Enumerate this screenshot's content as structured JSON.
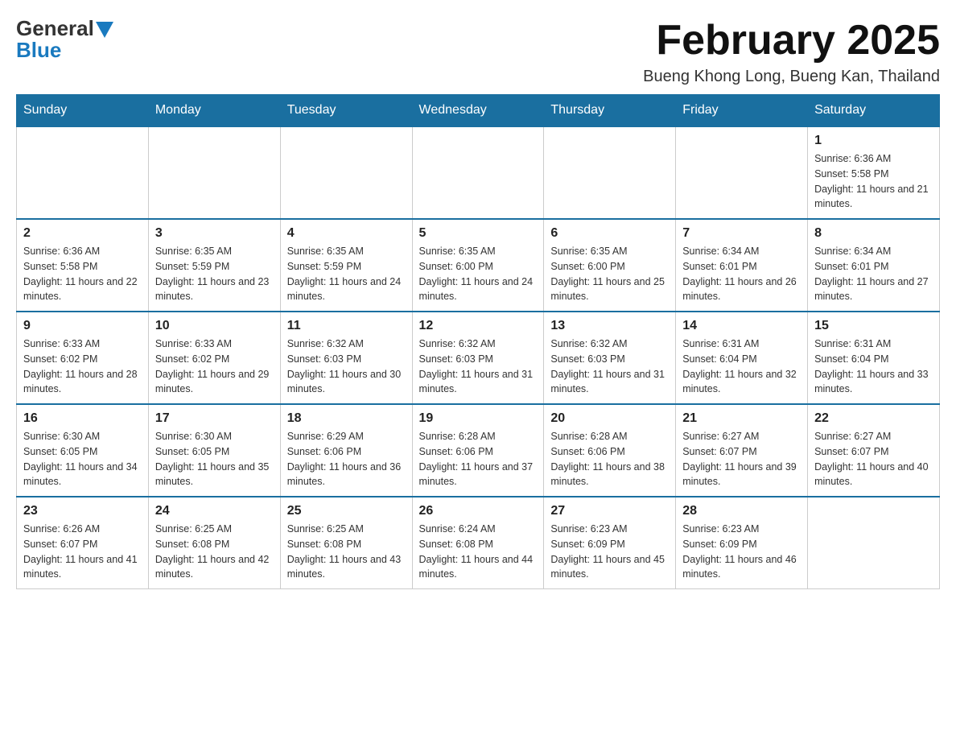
{
  "header": {
    "logo_general": "General",
    "logo_blue": "Blue",
    "month_title": "February 2025",
    "location": "Bueng Khong Long, Bueng Kan, Thailand"
  },
  "days_of_week": [
    "Sunday",
    "Monday",
    "Tuesday",
    "Wednesday",
    "Thursday",
    "Friday",
    "Saturday"
  ],
  "weeks": [
    [
      {
        "day": "",
        "info": ""
      },
      {
        "day": "",
        "info": ""
      },
      {
        "day": "",
        "info": ""
      },
      {
        "day": "",
        "info": ""
      },
      {
        "day": "",
        "info": ""
      },
      {
        "day": "",
        "info": ""
      },
      {
        "day": "1",
        "info": "Sunrise: 6:36 AM\nSunset: 5:58 PM\nDaylight: 11 hours and 21 minutes."
      }
    ],
    [
      {
        "day": "2",
        "info": "Sunrise: 6:36 AM\nSunset: 5:58 PM\nDaylight: 11 hours and 22 minutes."
      },
      {
        "day": "3",
        "info": "Sunrise: 6:35 AM\nSunset: 5:59 PM\nDaylight: 11 hours and 23 minutes."
      },
      {
        "day": "4",
        "info": "Sunrise: 6:35 AM\nSunset: 5:59 PM\nDaylight: 11 hours and 24 minutes."
      },
      {
        "day": "5",
        "info": "Sunrise: 6:35 AM\nSunset: 6:00 PM\nDaylight: 11 hours and 24 minutes."
      },
      {
        "day": "6",
        "info": "Sunrise: 6:35 AM\nSunset: 6:00 PM\nDaylight: 11 hours and 25 minutes."
      },
      {
        "day": "7",
        "info": "Sunrise: 6:34 AM\nSunset: 6:01 PM\nDaylight: 11 hours and 26 minutes."
      },
      {
        "day": "8",
        "info": "Sunrise: 6:34 AM\nSunset: 6:01 PM\nDaylight: 11 hours and 27 minutes."
      }
    ],
    [
      {
        "day": "9",
        "info": "Sunrise: 6:33 AM\nSunset: 6:02 PM\nDaylight: 11 hours and 28 minutes."
      },
      {
        "day": "10",
        "info": "Sunrise: 6:33 AM\nSunset: 6:02 PM\nDaylight: 11 hours and 29 minutes."
      },
      {
        "day": "11",
        "info": "Sunrise: 6:32 AM\nSunset: 6:03 PM\nDaylight: 11 hours and 30 minutes."
      },
      {
        "day": "12",
        "info": "Sunrise: 6:32 AM\nSunset: 6:03 PM\nDaylight: 11 hours and 31 minutes."
      },
      {
        "day": "13",
        "info": "Sunrise: 6:32 AM\nSunset: 6:03 PM\nDaylight: 11 hours and 31 minutes."
      },
      {
        "day": "14",
        "info": "Sunrise: 6:31 AM\nSunset: 6:04 PM\nDaylight: 11 hours and 32 minutes."
      },
      {
        "day": "15",
        "info": "Sunrise: 6:31 AM\nSunset: 6:04 PM\nDaylight: 11 hours and 33 minutes."
      }
    ],
    [
      {
        "day": "16",
        "info": "Sunrise: 6:30 AM\nSunset: 6:05 PM\nDaylight: 11 hours and 34 minutes."
      },
      {
        "day": "17",
        "info": "Sunrise: 6:30 AM\nSunset: 6:05 PM\nDaylight: 11 hours and 35 minutes."
      },
      {
        "day": "18",
        "info": "Sunrise: 6:29 AM\nSunset: 6:06 PM\nDaylight: 11 hours and 36 minutes."
      },
      {
        "day": "19",
        "info": "Sunrise: 6:28 AM\nSunset: 6:06 PM\nDaylight: 11 hours and 37 minutes."
      },
      {
        "day": "20",
        "info": "Sunrise: 6:28 AM\nSunset: 6:06 PM\nDaylight: 11 hours and 38 minutes."
      },
      {
        "day": "21",
        "info": "Sunrise: 6:27 AM\nSunset: 6:07 PM\nDaylight: 11 hours and 39 minutes."
      },
      {
        "day": "22",
        "info": "Sunrise: 6:27 AM\nSunset: 6:07 PM\nDaylight: 11 hours and 40 minutes."
      }
    ],
    [
      {
        "day": "23",
        "info": "Sunrise: 6:26 AM\nSunset: 6:07 PM\nDaylight: 11 hours and 41 minutes."
      },
      {
        "day": "24",
        "info": "Sunrise: 6:25 AM\nSunset: 6:08 PM\nDaylight: 11 hours and 42 minutes."
      },
      {
        "day": "25",
        "info": "Sunrise: 6:25 AM\nSunset: 6:08 PM\nDaylight: 11 hours and 43 minutes."
      },
      {
        "day": "26",
        "info": "Sunrise: 6:24 AM\nSunset: 6:08 PM\nDaylight: 11 hours and 44 minutes."
      },
      {
        "day": "27",
        "info": "Sunrise: 6:23 AM\nSunset: 6:09 PM\nDaylight: 11 hours and 45 minutes."
      },
      {
        "day": "28",
        "info": "Sunrise: 6:23 AM\nSunset: 6:09 PM\nDaylight: 11 hours and 46 minutes."
      },
      {
        "day": "",
        "info": ""
      }
    ]
  ]
}
